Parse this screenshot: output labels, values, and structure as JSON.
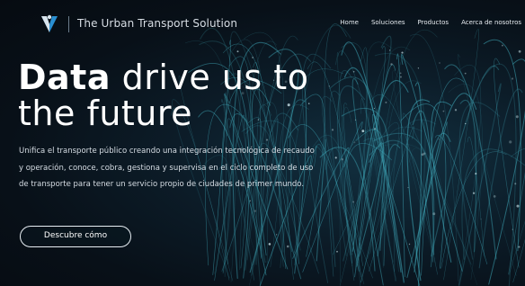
{
  "header": {
    "brand_name": "The Urban Transport Solution",
    "logo_icon": "v-logo-icon",
    "nav": [
      "Home",
      "Soluciones",
      "Productos",
      "Acerca de nosotros"
    ]
  },
  "hero": {
    "headline_bold": "Data",
    "headline_rest_line1": "drive us to",
    "headline_line2": "the future",
    "lead": "Unifica el transporte público creando una integración tecnológica de recaudo y operación, conoce, cobra, gestiona y supervisa en el ciclo completo de uso de transporte para tener un servicio propio de ciudades de primer mundo.",
    "cta_label": "Descubre cómo"
  },
  "colors": {
    "background": "#0b1420",
    "accent_teal": "#3fa7b8",
    "logo_light": "#d9e4ec",
    "logo_blue": "#2a8fd1"
  }
}
